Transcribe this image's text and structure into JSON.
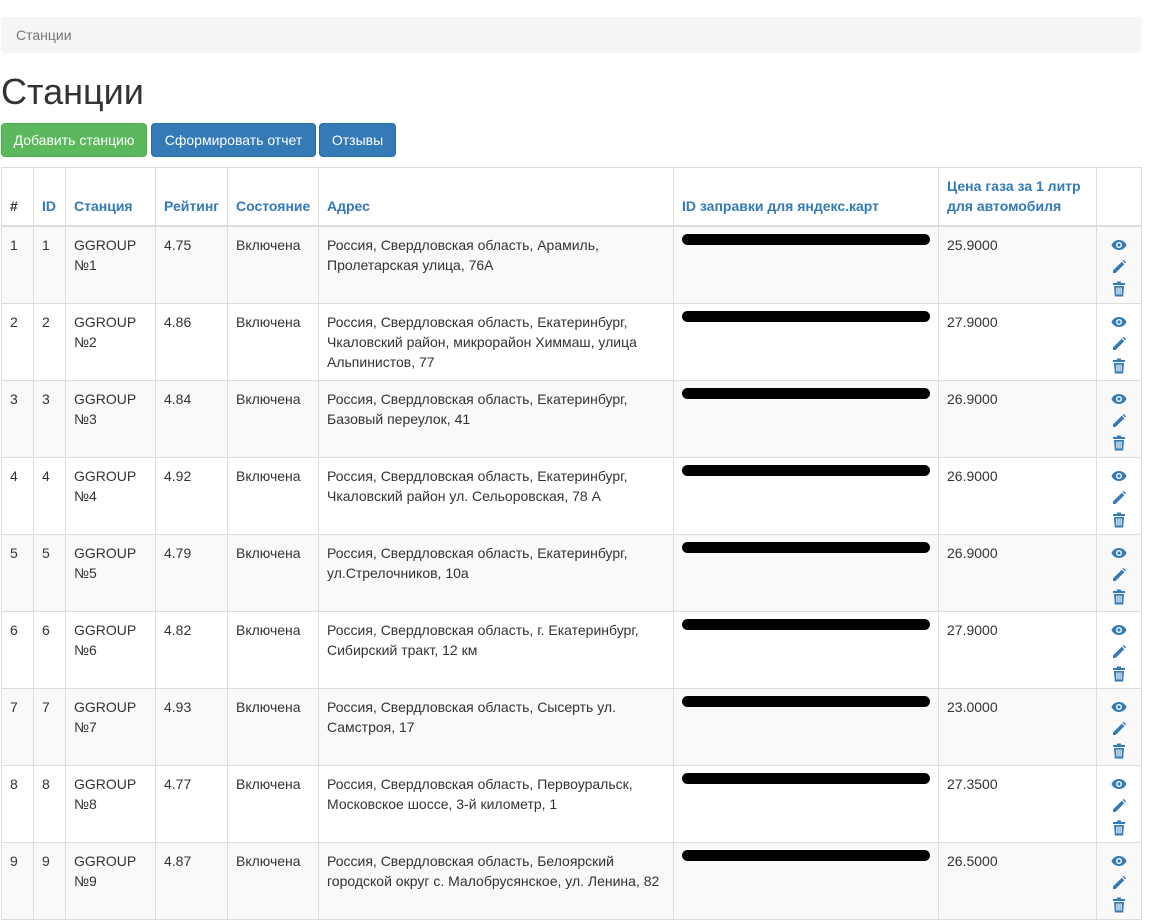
{
  "breadcrumb": {
    "current": "Станции"
  },
  "page_title": "Станции",
  "toolbar": {
    "add_label": "Добавить станцию",
    "report_label": "Сформировать отчет",
    "reviews_label": "Отзывы"
  },
  "table": {
    "columns": [
      "#",
      "ID",
      "Станция",
      "Рейтинг",
      "Состояние",
      "Адрес",
      "ID заправки для яндекс.карт",
      "Цена газа за 1 литр для автомобиля"
    ],
    "rows": [
      {
        "num": "1",
        "id": "1",
        "station": "GGROUP №1",
        "rating": "4.75",
        "state": "Включена",
        "address": "Россия, Свердловская область, Арамиль, Пролетарская улица, 76А",
        "yandex_id": "",
        "price": "25.9000"
      },
      {
        "num": "2",
        "id": "2",
        "station": "GGROUP №2",
        "rating": "4.86",
        "state": "Включена",
        "address": "Россия, Свердловская область, Екатеринбург, Чкаловский район, микрорайон Химмаш, улица Альпинистов, 77",
        "yandex_id": "",
        "price": "27.9000"
      },
      {
        "num": "3",
        "id": "3",
        "station": "GGROUP №3",
        "rating": "4.84",
        "state": "Включена",
        "address": "Россия, Свердловская область, Екатеринбург, Базовый переулок, 41",
        "yandex_id": "",
        "price": "26.9000"
      },
      {
        "num": "4",
        "id": "4",
        "station": "GGROUP №4",
        "rating": "4.92",
        "state": "Включена",
        "address": "Россия, Свердловская область, Екатеринбург, Чкаловский район ул. Сельоровская, 78 А",
        "yandex_id": "",
        "price": "26.9000"
      },
      {
        "num": "5",
        "id": "5",
        "station": "GGROUP №5",
        "rating": "4.79",
        "state": "Включена",
        "address": "Россия, Свердловская область, Екатеринбург, ул.Стрелочников, 10а",
        "yandex_id": "",
        "price": "26.9000"
      },
      {
        "num": "6",
        "id": "6",
        "station": "GGROUP №6",
        "rating": "4.82",
        "state": "Включена",
        "address": "Россия, Свердловская область, г. Екатеринбург, Сибирский тракт, 12 км",
        "yandex_id": "",
        "price": "27.9000"
      },
      {
        "num": "7",
        "id": "7",
        "station": "GGROUP №7",
        "rating": "4.93",
        "state": "Включена",
        "address": "Россия, Свердловская область, Сысерть ул. Самстроя, 17",
        "yandex_id": "",
        "price": "23.0000"
      },
      {
        "num": "8",
        "id": "8",
        "station": "GGROUP №8",
        "rating": "4.77",
        "state": "Включена",
        "address": "Россия, Свердловская область, Первоуральск, Московское шоссе, 3-й километр, 1",
        "yandex_id": "",
        "price": "27.3500"
      },
      {
        "num": "9",
        "id": "9",
        "station": "GGROUP №9",
        "rating": "4.87",
        "state": "Включена",
        "address": "Россия, Свердловская область, Белоярский городской округ с. Малобрусянское, ул. Ленина, 82",
        "yandex_id": "",
        "price": "26.5000"
      }
    ]
  },
  "icons": {
    "view": "eye-icon",
    "edit": "pencil-icon",
    "delete": "trash-icon"
  },
  "colors": {
    "link": "#337ab7",
    "success": "#5cb85c",
    "primary": "#337ab7",
    "breadcrumb_bg": "#f5f5f5"
  }
}
